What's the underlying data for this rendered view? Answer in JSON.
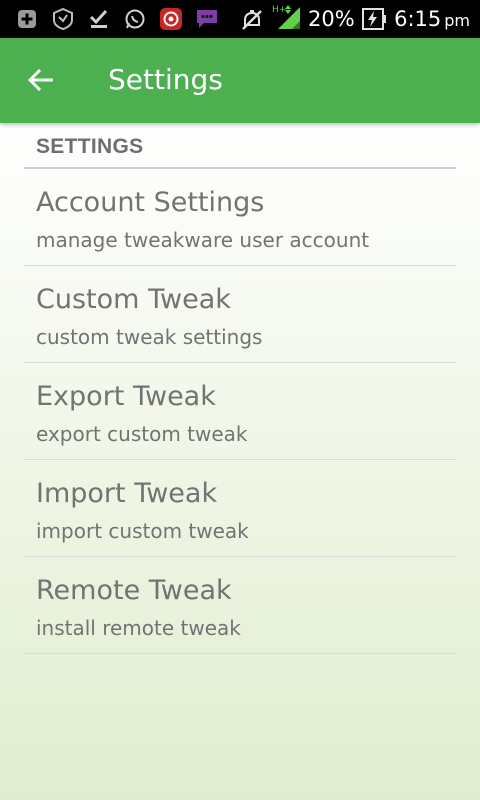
{
  "status_bar": {
    "icons": [
      "add-box-icon",
      "shield-icon",
      "check-download-icon",
      "whatsapp-icon",
      "record-app-icon",
      "chat-icon",
      "mute-icon",
      "signal-icon",
      "battery-charging-icon"
    ],
    "network_type": "H+",
    "battery_percent": "20%",
    "time": "6:15",
    "ampm": "pm"
  },
  "toolbar": {
    "back_icon": "arrow-left-icon",
    "title": "Settings",
    "color": "#4caf50"
  },
  "section": {
    "header": "SETTINGS"
  },
  "preferences": [
    {
      "title": "Account Settings",
      "summary": "manage tweakware user account"
    },
    {
      "title": "Custom Tweak",
      "summary": "custom tweak settings"
    },
    {
      "title": "Export Tweak",
      "summary": "export custom tweak"
    },
    {
      "title": "Import Tweak",
      "summary": "import custom tweak"
    },
    {
      "title": "Remote Tweak",
      "summary": "install remote tweak"
    }
  ]
}
